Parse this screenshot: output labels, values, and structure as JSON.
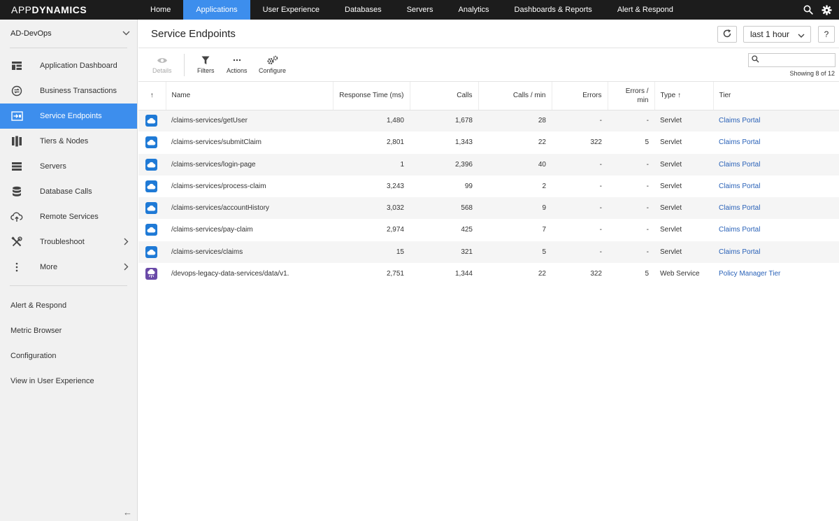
{
  "nav": {
    "logo_light": "APP",
    "logo_bold": "DYNAMICS",
    "items": [
      {
        "label": "Home",
        "active": false
      },
      {
        "label": "Applications",
        "active": true
      },
      {
        "label": "User Experience",
        "active": false
      },
      {
        "label": "Databases",
        "active": false
      },
      {
        "label": "Servers",
        "active": false
      },
      {
        "label": "Analytics",
        "active": false
      },
      {
        "label": "Dashboards & Reports",
        "active": false
      },
      {
        "label": "Alert & Respond",
        "active": false
      }
    ]
  },
  "sidebar": {
    "app_name": "AD-DevOps",
    "items": [
      {
        "label": "Application Dashboard",
        "icon": "dashboard-icon"
      },
      {
        "label": "Business Transactions",
        "icon": "transactions-icon"
      },
      {
        "label": "Service Endpoints",
        "icon": "endpoint-icon",
        "active": true
      },
      {
        "label": "Tiers & Nodes",
        "icon": "tiers-icon"
      },
      {
        "label": "Servers",
        "icon": "servers-icon"
      },
      {
        "label": "Database Calls",
        "icon": "database-icon"
      },
      {
        "label": "Remote Services",
        "icon": "cloud-upload-icon"
      },
      {
        "label": "Troubleshoot",
        "icon": "tools-icon"
      },
      {
        "label": "More",
        "icon": "more-vertical-icon"
      }
    ],
    "links": [
      "Alert & Respond",
      "Metric Browser",
      "Configuration",
      "View in User Experience"
    ],
    "collapse": "←"
  },
  "header": {
    "title": "Service Endpoints",
    "time_range": "last 1 hour",
    "help": "?"
  },
  "toolbar": {
    "details": "Details",
    "filters": "Filters",
    "actions": "Actions",
    "configure": "Configure",
    "search_placeholder": "",
    "showing": "Showing 8 of 12"
  },
  "table": {
    "sort_arrow": "↑",
    "columns": {
      "name": "Name",
      "response_time": "Response Time (ms)",
      "calls": "Calls",
      "calls_per_min": "Calls / min",
      "errors": "Errors",
      "errors_per_min_1": "Errors /",
      "errors_per_min_2": "min",
      "type": "Type ↑",
      "tier": "Tier"
    },
    "rows": [
      {
        "name": "/claims-services/getUser",
        "response_time": "1,480",
        "calls": "1,678",
        "cpm": "28",
        "errors": "-",
        "epm": "-",
        "type": "Servlet",
        "tier": "Claims Portal",
        "kind": "servlet"
      },
      {
        "name": "/claims-services/submitClaim",
        "response_time": "2,801",
        "calls": "1,343",
        "cpm": "22",
        "errors": "322",
        "epm": "5",
        "type": "Servlet",
        "tier": "Claims Portal",
        "kind": "servlet"
      },
      {
        "name": "/claims-services/login-page",
        "response_time": "1",
        "calls": "2,396",
        "cpm": "40",
        "errors": "-",
        "epm": "-",
        "type": "Servlet",
        "tier": "Claims Portal",
        "kind": "servlet"
      },
      {
        "name": "/claims-services/process-claim",
        "response_time": "3,243",
        "calls": "99",
        "cpm": "2",
        "errors": "-",
        "epm": "-",
        "type": "Servlet",
        "tier": "Claims Portal",
        "kind": "servlet"
      },
      {
        "name": "/claims-services/accountHistory",
        "response_time": "3,032",
        "calls": "568",
        "cpm": "9",
        "errors": "-",
        "epm": "-",
        "type": "Servlet",
        "tier": "Claims Portal",
        "kind": "servlet"
      },
      {
        "name": "/claims-services/pay-claim",
        "response_time": "2,974",
        "calls": "425",
        "cpm": "7",
        "errors": "-",
        "epm": "-",
        "type": "Servlet",
        "tier": "Claims Portal",
        "kind": "servlet"
      },
      {
        "name": "/claims-services/claims",
        "response_time": "15",
        "calls": "321",
        "cpm": "5",
        "errors": "-",
        "epm": "-",
        "type": "Servlet",
        "tier": "Claims Portal",
        "kind": "servlet"
      },
      {
        "name": "/devops-legacy-data-services/data/v1.",
        "response_time": "2,751",
        "calls": "1,344",
        "cpm": "22",
        "errors": "322",
        "epm": "5",
        "type": "Web Service",
        "tier": "Policy Manager Tier",
        "kind": "ws"
      }
    ]
  }
}
